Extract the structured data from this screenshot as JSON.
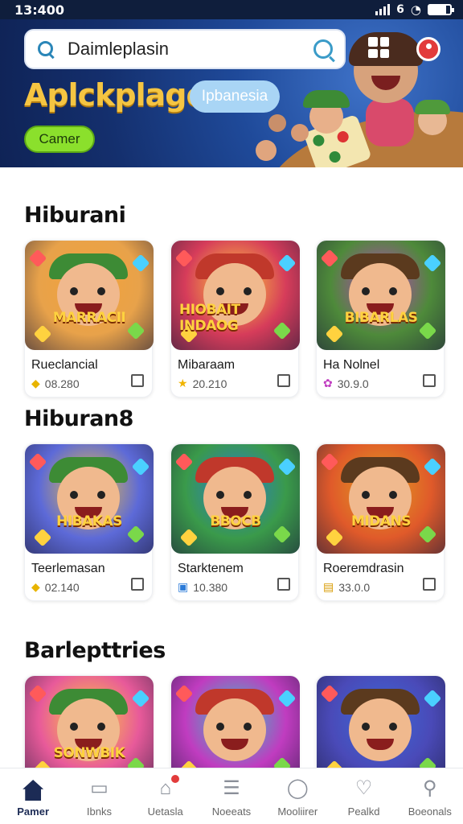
{
  "status_bar": {
    "time": "13:400",
    "network_label": "6",
    "battery_level": 0.8
  },
  "search": {
    "value": "Daimleplasin"
  },
  "hero": {
    "title": "Aplckplage",
    "region_label": "Ipbanesia",
    "game_button_label": "Camer"
  },
  "sections": [
    {
      "title": "Hiburani",
      "cards": [
        {
          "name": "Rueclancial",
          "rating": "08.280",
          "art_title": "MARRACII",
          "rating_icon": "shield-gem-icon",
          "accent": "#f2a33a",
          "bg": "#e8a24a"
        },
        {
          "name": "Mibaraam",
          "rating": "20.210",
          "art_title": "HIOBAIT INDAOG",
          "rating_icon": "star-icon",
          "accent": "#ffcf3a",
          "bg": "#d63c5a"
        },
        {
          "name": "Ha Nolnel",
          "rating": "30.9.0",
          "art_title": "BIBARLAS",
          "rating_icon": "flower-icon",
          "accent": "#c03cc0",
          "bg": "#4e8a3a"
        }
      ]
    },
    {
      "title": "Hiburan8",
      "cards": [
        {
          "name": "Teerlemasan",
          "rating": "02.140",
          "art_title": "HIBAKAS",
          "rating_icon": "shield-gem-icon",
          "accent": "#f2c23a",
          "bg": "#5d6ad8"
        },
        {
          "name": "Starktenem",
          "rating": "10.380",
          "art_title": "BBOCB",
          "rating_icon": "controller-icon",
          "accent": "#2a7ad8",
          "bg": "#3a9a4a"
        },
        {
          "name": "Roeremdrasin",
          "rating": "33.0.0",
          "art_title": "MIDANS",
          "rating_icon": "ticket-icon",
          "accent": "#e0a020",
          "bg": "#e05a2a"
        }
      ]
    },
    {
      "title": "Barlepttries",
      "cards": [
        {
          "art_title": "SONWBIK",
          "accent": "#ffcf3a",
          "bg": "#e85a9a"
        },
        {
          "art_title": "",
          "accent": "#2ad0c0",
          "bg": "#c03cc0"
        },
        {
          "art_title": "",
          "accent": "#3a6ad8",
          "bg": "#4a4ab8"
        }
      ]
    }
  ],
  "bottom_nav": [
    {
      "label": "Pamer",
      "icon": "home-icon",
      "active": true
    },
    {
      "label": "Ibnks",
      "icon": "card-icon",
      "active": false
    },
    {
      "label": "Uetasla",
      "icon": "store-icon",
      "active": false,
      "badge": true
    },
    {
      "label": "Noeeats",
      "icon": "list-icon",
      "active": false
    },
    {
      "label": "Mooliirer",
      "icon": "chat-icon",
      "active": false
    },
    {
      "label": "Pealkd",
      "icon": "heart-icon",
      "active": false
    },
    {
      "label": "Boeonals",
      "icon": "profile-icon",
      "active": false
    }
  ]
}
